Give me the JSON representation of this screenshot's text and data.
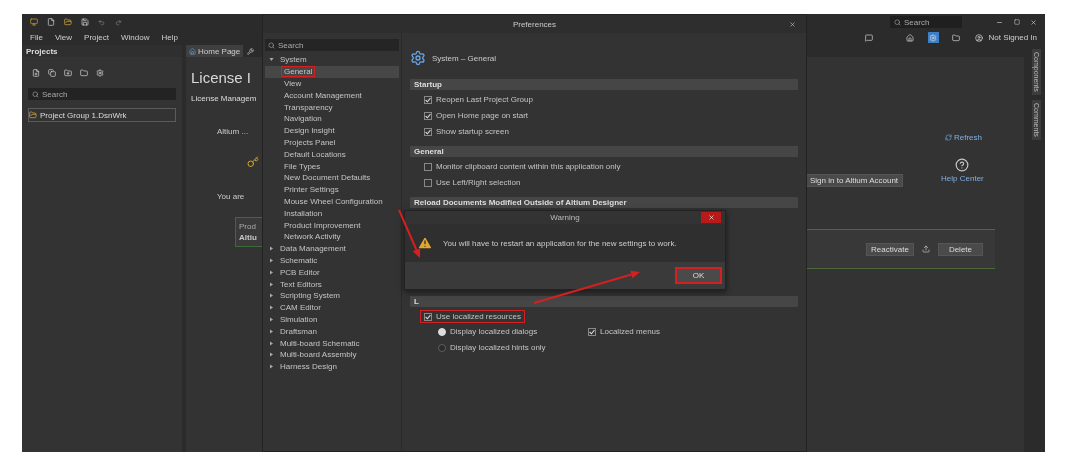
{
  "app": {
    "search": {
      "placeholder": "Search"
    },
    "menu": [
      "File",
      "View",
      "Project",
      "Window",
      "Help"
    ],
    "account": "Not Signed In"
  },
  "projects_panel": {
    "title": "Projects",
    "search": {
      "placeholder": "Search"
    },
    "items": [
      {
        "label": "Project Group 1.DsnWrk",
        "selected": true
      }
    ]
  },
  "document": {
    "tabs": [
      {
        "label": "Home Page",
        "selected": true
      }
    ],
    "title": "License I",
    "subtitle": "License Managem",
    "left_texts": [
      "Altium ...",
      "You are"
    ],
    "product_box": {
      "label": "Prod",
      "value": "Altiu"
    },
    "refresh": "Refresh",
    "sign_in": "Sign in to Altium Account",
    "help": "Help Center",
    "actions": [
      "Reactivate",
      "Delete"
    ]
  },
  "side_tabs": [
    "Components",
    "Comments"
  ],
  "preferences": {
    "title": "Preferences",
    "search": {
      "placeholder": "Search"
    },
    "tree": [
      {
        "label": "System",
        "expanded": true,
        "children": [
          {
            "label": "General",
            "selected": true,
            "highlighted": true
          },
          {
            "label": "View",
            "selected": false
          },
          {
            "label": "Account Management",
            "selected": false
          },
          {
            "label": "Transparency",
            "selected": false
          },
          {
            "label": "Navigation",
            "selected": false
          },
          {
            "label": "Design Insight",
            "selected": false
          },
          {
            "label": "Projects Panel",
            "selected": false
          },
          {
            "label": "Default Locations",
            "selected": false
          },
          {
            "label": "File Types",
            "selected": false
          },
          {
            "label": "New Document Defaults",
            "selected": false
          },
          {
            "label": "Printer Settings",
            "selected": false
          },
          {
            "label": "Mouse Wheel Configuration",
            "selected": false
          },
          {
            "label": "Installation",
            "selected": false
          },
          {
            "label": "Product Improvement",
            "selected": false
          },
          {
            "label": "Network Activity",
            "selected": false
          }
        ]
      },
      {
        "label": "Data Management",
        "expanded": false
      },
      {
        "label": "Schematic",
        "expanded": false
      },
      {
        "label": "PCB Editor",
        "expanded": false
      },
      {
        "label": "Text Editors",
        "expanded": false
      },
      {
        "label": "Scripting System",
        "expanded": false
      },
      {
        "label": "CAM Editor",
        "expanded": false
      },
      {
        "label": "Simulation",
        "expanded": false
      },
      {
        "label": "Draftsman",
        "expanded": false
      },
      {
        "label": "Multi-board Schematic",
        "expanded": false
      },
      {
        "label": "Multi-board Assembly",
        "expanded": false
      },
      {
        "label": "Harness Design",
        "expanded": false
      }
    ],
    "page_title": "System – General",
    "sections": [
      {
        "title": "Startup",
        "options": [
          {
            "kind": "checkbox",
            "label": "Reopen Last Project Group",
            "checked": true
          },
          {
            "kind": "checkbox",
            "label": "Open Home page on start",
            "checked": true
          },
          {
            "kind": "checkbox",
            "label": "Show startup screen",
            "checked": true
          }
        ]
      },
      {
        "title": "General",
        "options": [
          {
            "kind": "checkbox",
            "label": "Monitor clipboard content within this application only",
            "checked": false
          },
          {
            "kind": "checkbox",
            "label": "Use Left/Right selection",
            "checked": false
          }
        ]
      },
      {
        "title": "Reload Documents Modified Outside of Altium Designer"
      },
      {
        "title": "L",
        "options": [
          {
            "kind": "checkbox",
            "label": "Use localized resources",
            "checked": true,
            "highlighted": true,
            "children": [
              {
                "kind": "radio",
                "label": "Display localized dialogs",
                "selected": true
              },
              {
                "kind": "checkbox",
                "label": "Localized menus",
                "checked": true
              },
              {
                "kind": "radio",
                "label": "Display localized hints only",
                "selected": false
              }
            ]
          }
        ]
      }
    ]
  },
  "warning": {
    "title": "Warning",
    "message": "You will have to restart an application for the new settings to work.",
    "button": {
      "label": "OK",
      "highlighted": true
    }
  }
}
